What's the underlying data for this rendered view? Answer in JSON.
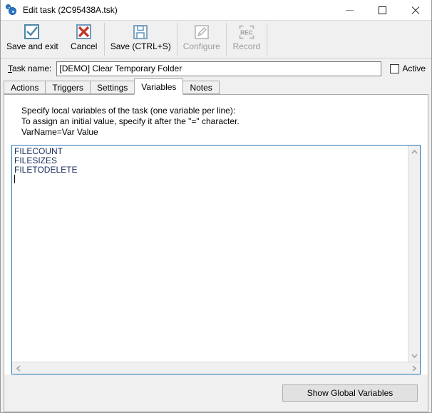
{
  "window": {
    "title": "Edit task (2C95438A.tsk)",
    "icon": "gears-icon",
    "controls": {
      "minimize": "minimize-icon",
      "maximize": "maximize-icon",
      "close": "close-icon"
    }
  },
  "toolbar": {
    "buttons": [
      {
        "label": "Save and exit",
        "icon": "checkbox-check-icon",
        "enabled": true
      },
      {
        "label": "Cancel",
        "icon": "red-x-icon",
        "enabled": true
      },
      {
        "label": "Save (CTRL+S)",
        "icon": "floppy-disk-icon",
        "enabled": true
      },
      {
        "label": "Configure",
        "icon": "pencil-icon",
        "enabled": false
      },
      {
        "label": "Record",
        "icon": "rec-icon",
        "enabled": false
      }
    ]
  },
  "task": {
    "name_label": "Task name:",
    "name_accelerator": "T",
    "name_value": "[DEMO] Clear Temporary Folder",
    "name_placeholder": "",
    "active_label": "Active",
    "active_checked": false
  },
  "tabs": [
    {
      "label": "Actions",
      "active": false
    },
    {
      "label": "Triggers",
      "active": false
    },
    {
      "label": "Settings",
      "active": false
    },
    {
      "label": "Variables",
      "active": true
    },
    {
      "label": "Notes",
      "active": false
    }
  ],
  "variables_panel": {
    "instructions": [
      "Specify local variables of the task (one variable per line):",
      "To assign an initial value, specify it after the \"=\" character.",
      "VarName=Var Value"
    ],
    "editor_lines": [
      "FILECOUNT",
      "FILESIZES",
      "FILETODELETE"
    ],
    "editor_value": "FILECOUNT\nFILESIZES\nFILETODELETE\n",
    "caret_line": 4,
    "scroll": {
      "v_up_arrow": "chevron-up-icon",
      "v_down_arrow": "chevron-down-icon",
      "h_left_arrow": "chevron-left-icon",
      "h_right_arrow": "chevron-right-icon"
    },
    "show_global_button": "Show Global Variables"
  },
  "colors": {
    "accent_border": "#2679b5",
    "icon_blue": "#4f86a8",
    "icon_red": "#c0392b",
    "text_blue": "#1b2f5c",
    "disabled_text": "#9d9d9d",
    "window_bg": "#f0f0f0"
  }
}
